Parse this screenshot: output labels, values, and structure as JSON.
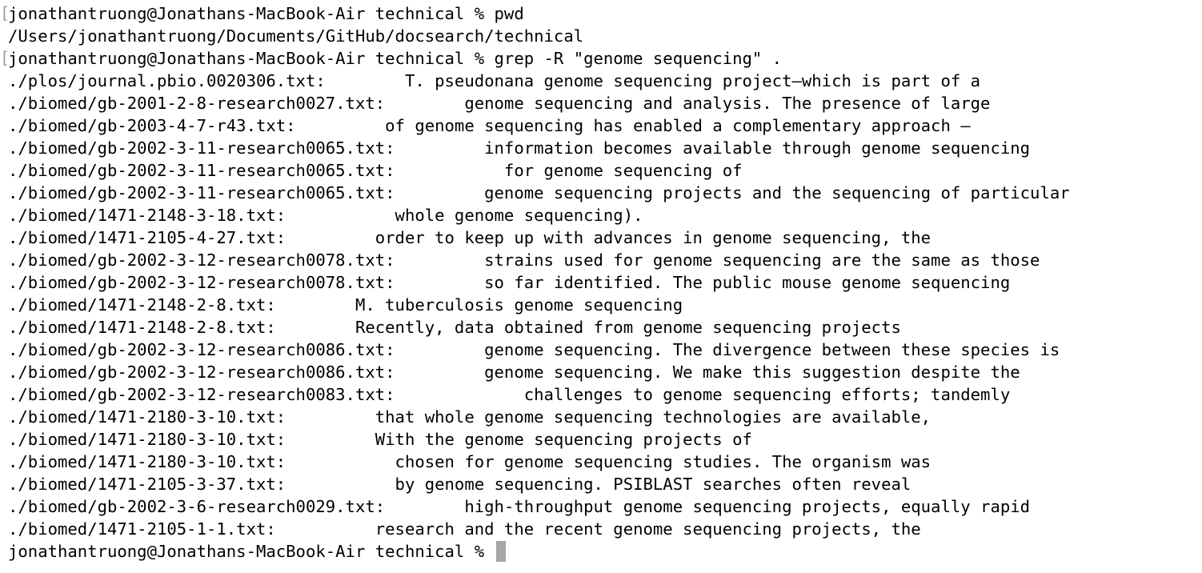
{
  "terminal": {
    "prompt": "jonathantruong@Jonathans-MacBook-Air technical % ",
    "command_marker": "[",
    "lines": [
      {
        "marker": "[",
        "text": "jonathantruong@Jonathans-MacBook-Air technical % pwd"
      },
      {
        "marker": "",
        "text": "/Users/jonathantruong/Documents/GitHub/docsearch/technical"
      },
      {
        "marker": "[",
        "text": "jonathantruong@Jonathans-MacBook-Air technical % grep -R \"genome sequencing\" ."
      },
      {
        "marker": "",
        "text": "./plos/journal.pbio.0020306.txt:        T. pseudonana genome sequencing project—which is part of a"
      },
      {
        "marker": "",
        "text": "./biomed/gb-2001-2-8-research0027.txt:        genome sequencing and analysis. The presence of large"
      },
      {
        "marker": "",
        "text": "./biomed/gb-2003-4-7-r43.txt:         of genome sequencing has enabled a complementary approach –"
      },
      {
        "marker": "",
        "text": "./biomed/gb-2002-3-11-research0065.txt:         information becomes available through genome sequencing"
      },
      {
        "marker": "",
        "text": "./biomed/gb-2002-3-11-research0065.txt:           for genome sequencing of"
      },
      {
        "marker": "",
        "text": "./biomed/gb-2002-3-11-research0065.txt:         genome sequencing projects and the sequencing of particular"
      },
      {
        "marker": "",
        "text": "./biomed/1471-2148-3-18.txt:           whole genome sequencing)."
      },
      {
        "marker": "",
        "text": "./biomed/1471-2105-4-27.txt:         order to keep up with advances in genome sequencing, the"
      },
      {
        "marker": "",
        "text": "./biomed/gb-2002-3-12-research0078.txt:         strains used for genome sequencing are the same as those"
      },
      {
        "marker": "",
        "text": "./biomed/gb-2002-3-12-research0078.txt:         so far identified. The public mouse genome sequencing"
      },
      {
        "marker": "",
        "text": "./biomed/1471-2148-2-8.txt:        M. tuberculosis genome sequencing"
      },
      {
        "marker": "",
        "text": "./biomed/1471-2148-2-8.txt:        Recently, data obtained from genome sequencing projects"
      },
      {
        "marker": "",
        "text": "./biomed/gb-2002-3-12-research0086.txt:         genome sequencing. The divergence between these species is"
      },
      {
        "marker": "",
        "text": "./biomed/gb-2002-3-12-research0086.txt:         genome sequencing. We make this suggestion despite the"
      },
      {
        "marker": "",
        "text": "./biomed/gb-2002-3-12-research0083.txt:             challenges to genome sequencing efforts; tandemly"
      },
      {
        "marker": "",
        "text": "./biomed/1471-2180-3-10.txt:         that whole genome sequencing technologies are available,"
      },
      {
        "marker": "",
        "text": "./biomed/1471-2180-3-10.txt:         With the genome sequencing projects of"
      },
      {
        "marker": "",
        "text": "./biomed/1471-2180-3-10.txt:           chosen for genome sequencing studies. The organism was"
      },
      {
        "marker": "",
        "text": "./biomed/1471-2105-3-37.txt:           by genome sequencing. PSIBLAST searches often reveal"
      },
      {
        "marker": "",
        "text": "./biomed/gb-2002-3-6-research0029.txt:        high-throughput genome sequencing projects, equally rapid"
      },
      {
        "marker": "",
        "text": "./biomed/1471-2105-1-1.txt:          research and the recent genome sequencing projects, the"
      }
    ]
  },
  "colors": {
    "background": "#ffffff",
    "text": "#000000",
    "cursor": "#a6a6a6"
  }
}
